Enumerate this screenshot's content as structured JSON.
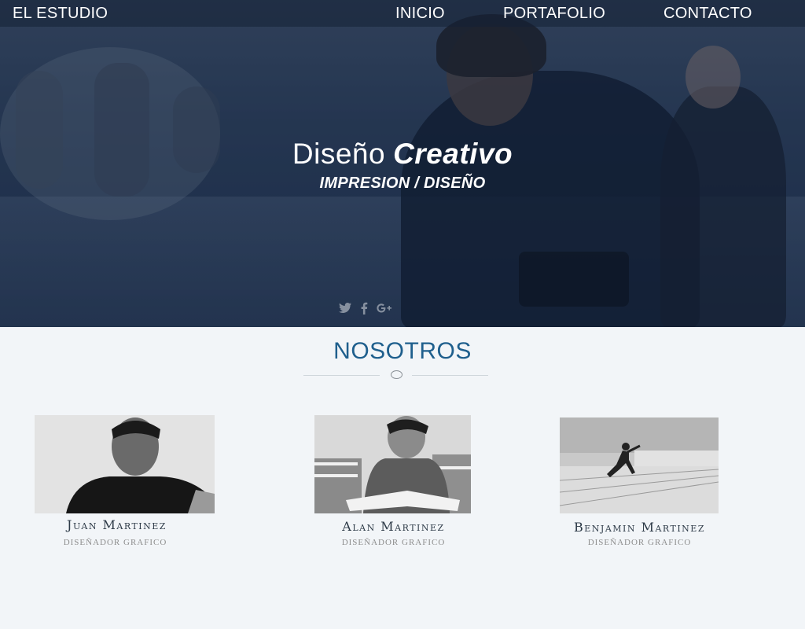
{
  "nav": {
    "brand": "EL ESTUDIO",
    "links": [
      "INICIO",
      "PORTAFOLIO",
      "CONTACTO"
    ]
  },
  "hero": {
    "title_regular": "Diseño",
    "title_bold": "Creativo",
    "subtitle": "IMPRESION / DISEÑO",
    "social_icons": [
      "twitter-icon",
      "facebook-icon",
      "google-plus-icon"
    ]
  },
  "team": {
    "heading": "NOSOTROS",
    "members": [
      {
        "name": "Juan Martinez",
        "role": "DISEÑADOR GRAFICO"
      },
      {
        "name": "Alan Martinez",
        "role": "DISEÑADOR GRAFICO"
      },
      {
        "name": "Benjamin Martinez",
        "role": "DISEÑADOR GRAFICO"
      }
    ]
  },
  "colors": {
    "accent": "#1f5f8d",
    "hero_overlay": "#1f2f47",
    "page_background": "#f2f5f8"
  }
}
